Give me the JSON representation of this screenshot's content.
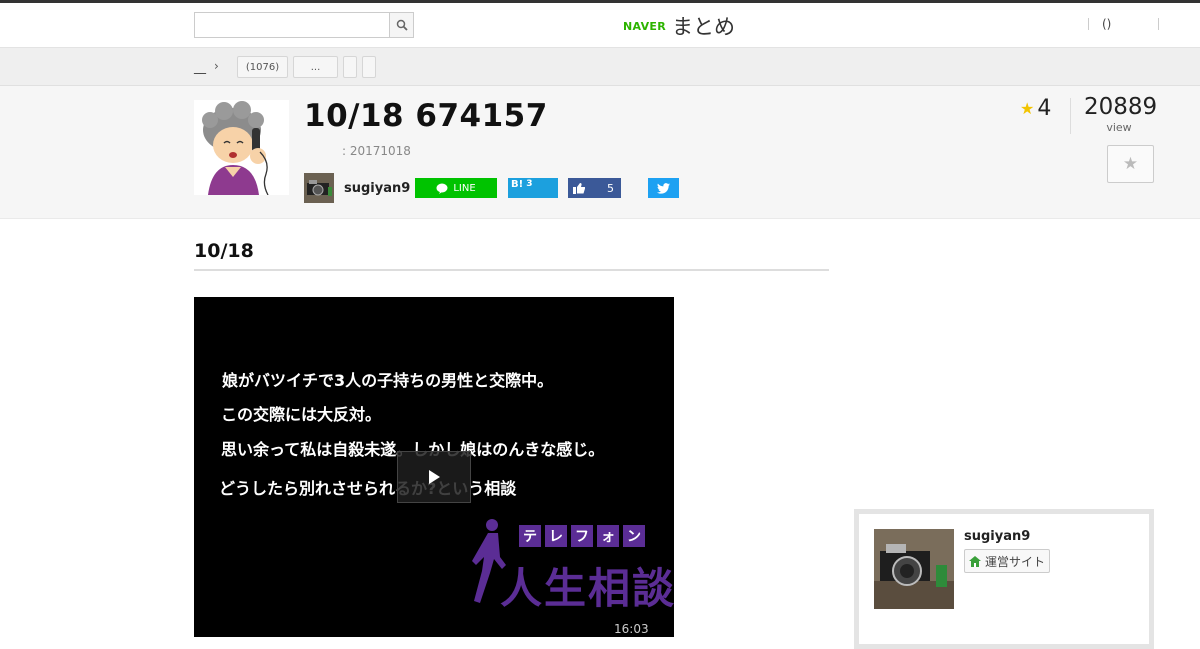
{
  "header": {
    "search": {
      "value": "",
      "placeholder": ""
    },
    "logo": {
      "brand": "NAVER",
      "service": "まとめ"
    },
    "right": {
      "label": "()"
    }
  },
  "breadcrumb": {
    "home": "__",
    "arrow": "›",
    "tags": [
      "(1076)",
      "...",
      "",
      ""
    ]
  },
  "article": {
    "title": "10/18  674157",
    "date": ": 20171018",
    "author": "sugiyan9",
    "share": {
      "line_label": "LINE",
      "hatena_label": "B!",
      "hatena_count": "3",
      "facebook_count": "5"
    },
    "favorites": "4",
    "views": "20889",
    "views_label": "view"
  },
  "section": {
    "heading": "10/18"
  },
  "video": {
    "lines": [
      "娘がバツイチで3人の子持ちの男性と交際中。",
      "この交際には大反対。",
      "思い余って私は自殺未遂。しかし娘はのんきな感じ。",
      "どうしたら別れさせられるか?という相談"
    ],
    "tel_chars": [
      "テ",
      "レ",
      "フ",
      "ォ",
      "ン"
    ],
    "program": "人生相談",
    "duration": "16:03"
  },
  "sidebar": {
    "author": "sugiyan9",
    "site_button": "運営サイト"
  },
  "colors": {
    "naver_green": "#2db400",
    "line_green": "#00c300",
    "hatena_blue": "#1ca0de",
    "facebook_blue": "#3b5998",
    "twitter_blue": "#1da1f2",
    "telephone_purple": "#5b2d95",
    "star_yellow": "#f2c400"
  },
  "icons": {
    "search": "magnifier-icon",
    "favorite": "star-icon",
    "play": "play-icon",
    "home": "house-icon"
  }
}
